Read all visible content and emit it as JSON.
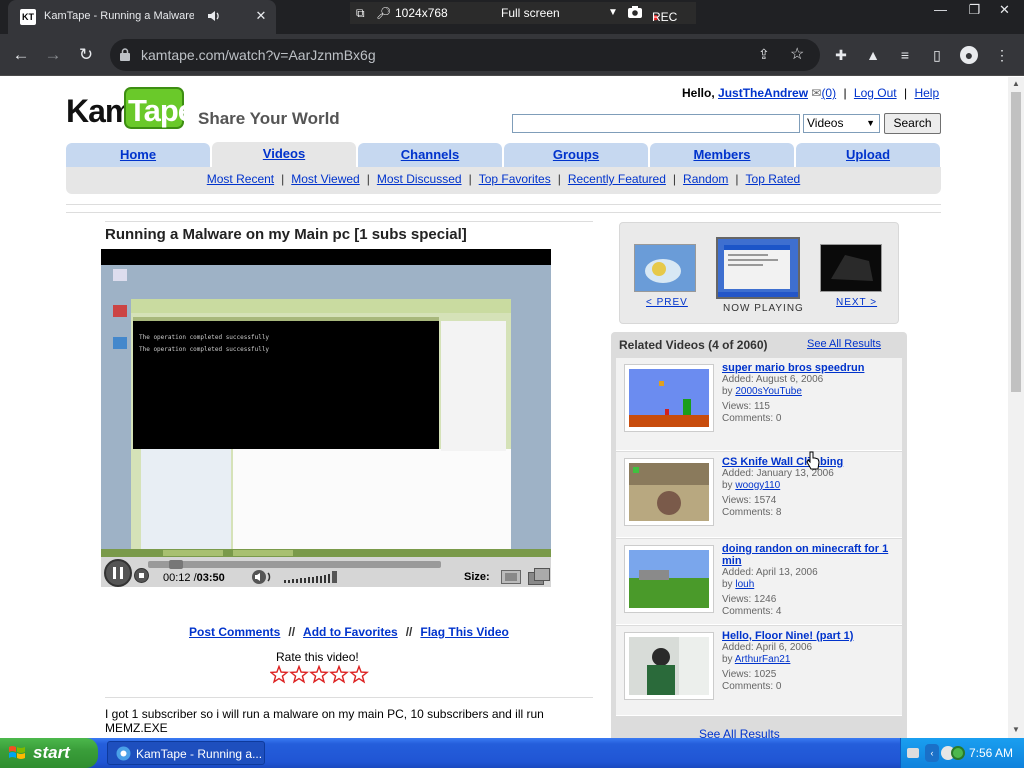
{
  "browser": {
    "tab_title": "KamTape - Running a Malware o",
    "recorder": {
      "resolution": "1024x768",
      "mode": "Full screen",
      "rec_label": "REC"
    },
    "url": "kamtape.com/watch?v=AarJznmBx6g"
  },
  "site": {
    "logo_kam": "Kam",
    "logo_tape": "Tape",
    "slogan": "Share Your World",
    "user_bar": {
      "greeting": "Hello,",
      "username": "JustTheAndrew",
      "mail_count": "(0)",
      "logout": "Log Out",
      "help": "Help"
    },
    "search": {
      "category": "Videos",
      "button": "Search"
    },
    "nav_tabs": [
      "Home",
      "Videos",
      "Channels",
      "Groups",
      "Members",
      "Upload"
    ],
    "active_tab": "Videos",
    "sub_nav": [
      "Most Recent",
      "Most Viewed",
      "Most Discussed",
      "Top Favorites",
      "Recently Featured",
      "Random",
      "Top Rated"
    ]
  },
  "video": {
    "title": "Running a Malware on my Main pc [1 subs special]",
    "time_current": "00:12",
    "time_total": "03:50",
    "size_label": "Size:",
    "progress": 0.052,
    "actions": [
      "Post Comments",
      "Add to Favorites",
      "Flag This Video"
    ],
    "rate_label": "Rate this video!",
    "stars": 5,
    "description": "I got 1 subscriber so i will run a malware on my main PC, 10 subscribers and ill run MEMZ.EXE"
  },
  "now_playing": {
    "prev": "< PREV",
    "now": "NOW PLAYING",
    "next": "NEXT >"
  },
  "related": {
    "header": "Related Videos (4 of 2060)",
    "see_all_top": "See All Results",
    "see_all_bottom": "See All Results",
    "items": [
      {
        "title": "super mario bros speedrun",
        "added": "Added: August 6, 2006",
        "by_prefix": "by",
        "by": "2000sYouTube",
        "views": "Views: 115",
        "comments": "Comments: 0"
      },
      {
        "title": "CS Knife Wall Climbing",
        "added": "Added: January 13, 2006",
        "by_prefix": "by",
        "by": "woogy110",
        "views": "Views: 1574",
        "comments": "Comments: 8"
      },
      {
        "title": "doing randon on minecraft for 1 min",
        "added": "Added: April 13, 2006",
        "by_prefix": "by",
        "by": "louh",
        "views": "Views: 1246",
        "comments": "Comments: 4"
      },
      {
        "title": "Hello, Floor Nine! (part 1)",
        "added": "Added: April 6, 2006",
        "by_prefix": "by",
        "by": "ArthurFan21",
        "views": "Views: 1025",
        "comments": "Comments: 0"
      }
    ]
  },
  "taskbar": {
    "start": "start",
    "task_item": "KamTape - Running a...",
    "clock": "7:56 AM"
  },
  "colors": {
    "link": "#0033cc",
    "nav_tab": "#c6d8f0",
    "taskbar": "#245edb",
    "start_button": "#3a9e3a"
  }
}
